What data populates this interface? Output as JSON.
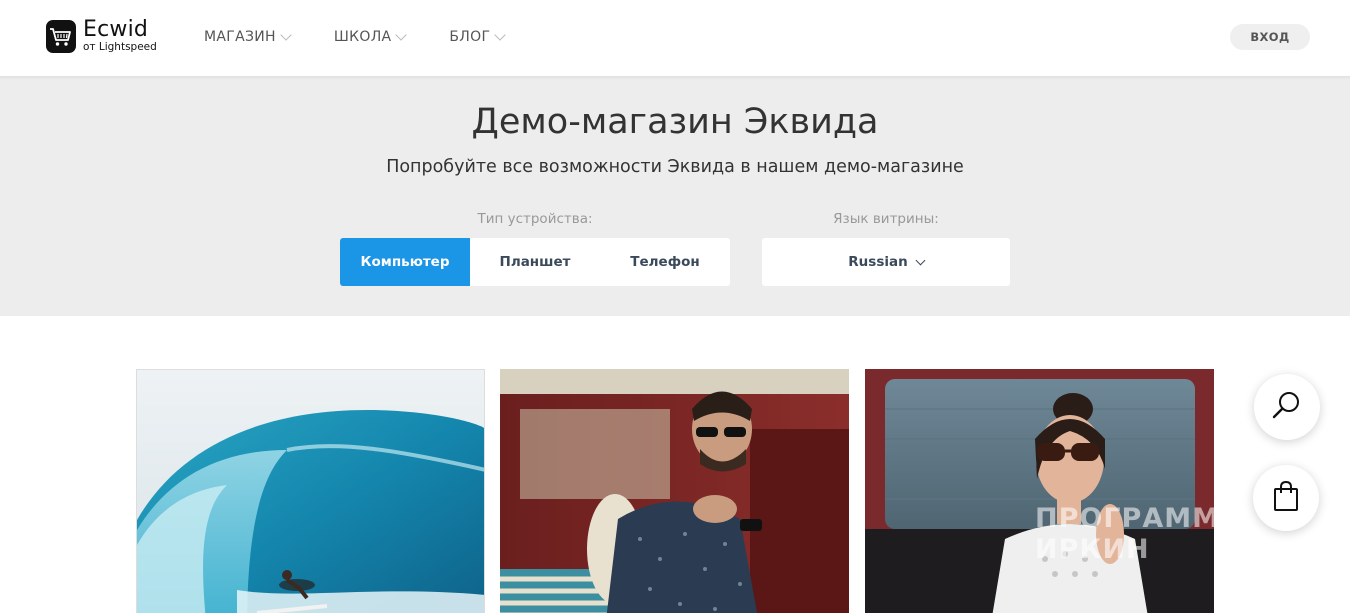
{
  "header": {
    "logo": {
      "name": "Ecwid",
      "sub": "от Lightspeed"
    },
    "nav": [
      {
        "label": "МАГАЗИН"
      },
      {
        "label": "ШКОЛА"
      },
      {
        "label": "БЛОГ"
      }
    ],
    "login_label": "ВХОД"
  },
  "hero": {
    "title": "Демо-магазин Эквида",
    "subtitle": "Попробуйте все возможности Эквида в нашем демо-магазине",
    "device_label": "Тип устройства:",
    "devices": [
      {
        "label": "Компьютер",
        "active": true
      },
      {
        "label": "Планшет",
        "active": false
      },
      {
        "label": "Телефон",
        "active": false
      }
    ],
    "language_label": "Язык витрины:",
    "language_value": "Russian"
  },
  "products": [
    {
      "image": "surfer-wave-photo"
    },
    {
      "image": "man-sunglasses-van-photo"
    },
    {
      "image": "woman-sunglasses-car-photo"
    }
  ],
  "floating": {
    "search_icon": "search-icon",
    "bag_icon": "shopping-bag-icon"
  },
  "watermark": "ПРОГРАММА ИРКИН",
  "colors": {
    "accent": "#1b95e6",
    "hero_bg": "#ededed",
    "text_dark": "#333333"
  }
}
